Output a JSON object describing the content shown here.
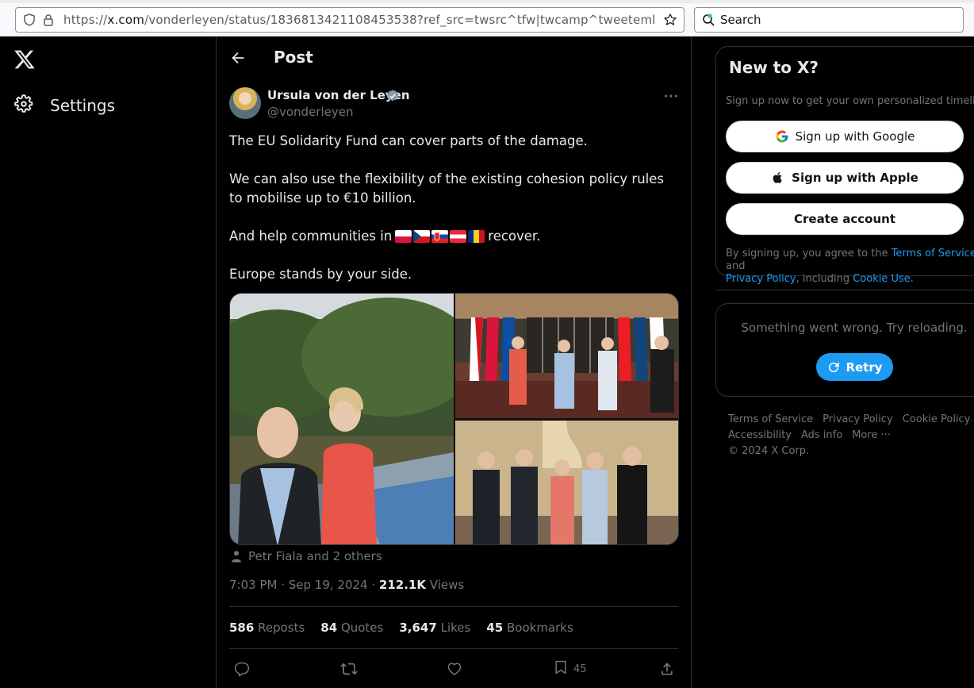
{
  "browser": {
    "url_prefix": "https://",
    "url_domain": "x.com",
    "url_rest": "/vonderleyen/status/1836813421108453538?ref_src=twsrc^tfw|twcamp^tweetembed|twterm",
    "search_placeholder": "Search"
  },
  "nav": {
    "settings_label": "Settings"
  },
  "post": {
    "header_title": "Post",
    "author_name": "Ursula von der Leyen",
    "author_handle": "@vonderleyen",
    "text_line1": "The EU Solidarity Fund can cover parts of the damage.",
    "text_line2": "We can also use the flexibility of the existing cohesion policy rules to mobilise up to €10 billion.",
    "text_line3_before": "And help communities in",
    "text_line3_after": "recover.",
    "text_line4": "Europe stands by your side.",
    "flags": [
      "poland",
      "czechia",
      "slovakia",
      "austria",
      "romania"
    ],
    "tagged": "Petr Fiala and 2 others",
    "time": "7:03 PM · Sep 19, 2024 ·",
    "views_count": "212.1K",
    "views_label": "Views",
    "stats": {
      "reposts_count": "586",
      "reposts_label": "Reposts",
      "quotes_count": "84",
      "quotes_label": "Quotes",
      "likes_count": "3,647",
      "likes_label": "Likes",
      "bookmarks_count": "45",
      "bookmarks_label": "Bookmarks"
    },
    "actions": {
      "bookmark_count": "45"
    }
  },
  "signup": {
    "title": "New to X?",
    "subtitle": "Sign up now to get your own personalized timeline!",
    "google_label": "Sign up with Google",
    "apple_label": "Sign up with Apple",
    "create_label": "Create account",
    "legal_prefix": "By signing up, you agree to the",
    "terms_link": "Terms of Service",
    "legal_and": "and",
    "privacy_link": "Privacy Policy",
    "legal_including": ", including",
    "cookie_link": "Cookie Use."
  },
  "error": {
    "message": "Something went wrong. Try reloading.",
    "retry_label": "Retry"
  },
  "footer": {
    "terms": "Terms of Service",
    "privacy": "Privacy Policy",
    "cookie": "Cookie Policy",
    "accessibility": "Accessibility",
    "ads": "Ads info",
    "more": "More ···",
    "copyright": "© 2024 X Corp."
  },
  "colors": {
    "accent": "#1d9bf0",
    "background": "#000000",
    "muted_text": "#71767b",
    "border": "#2f3336"
  }
}
